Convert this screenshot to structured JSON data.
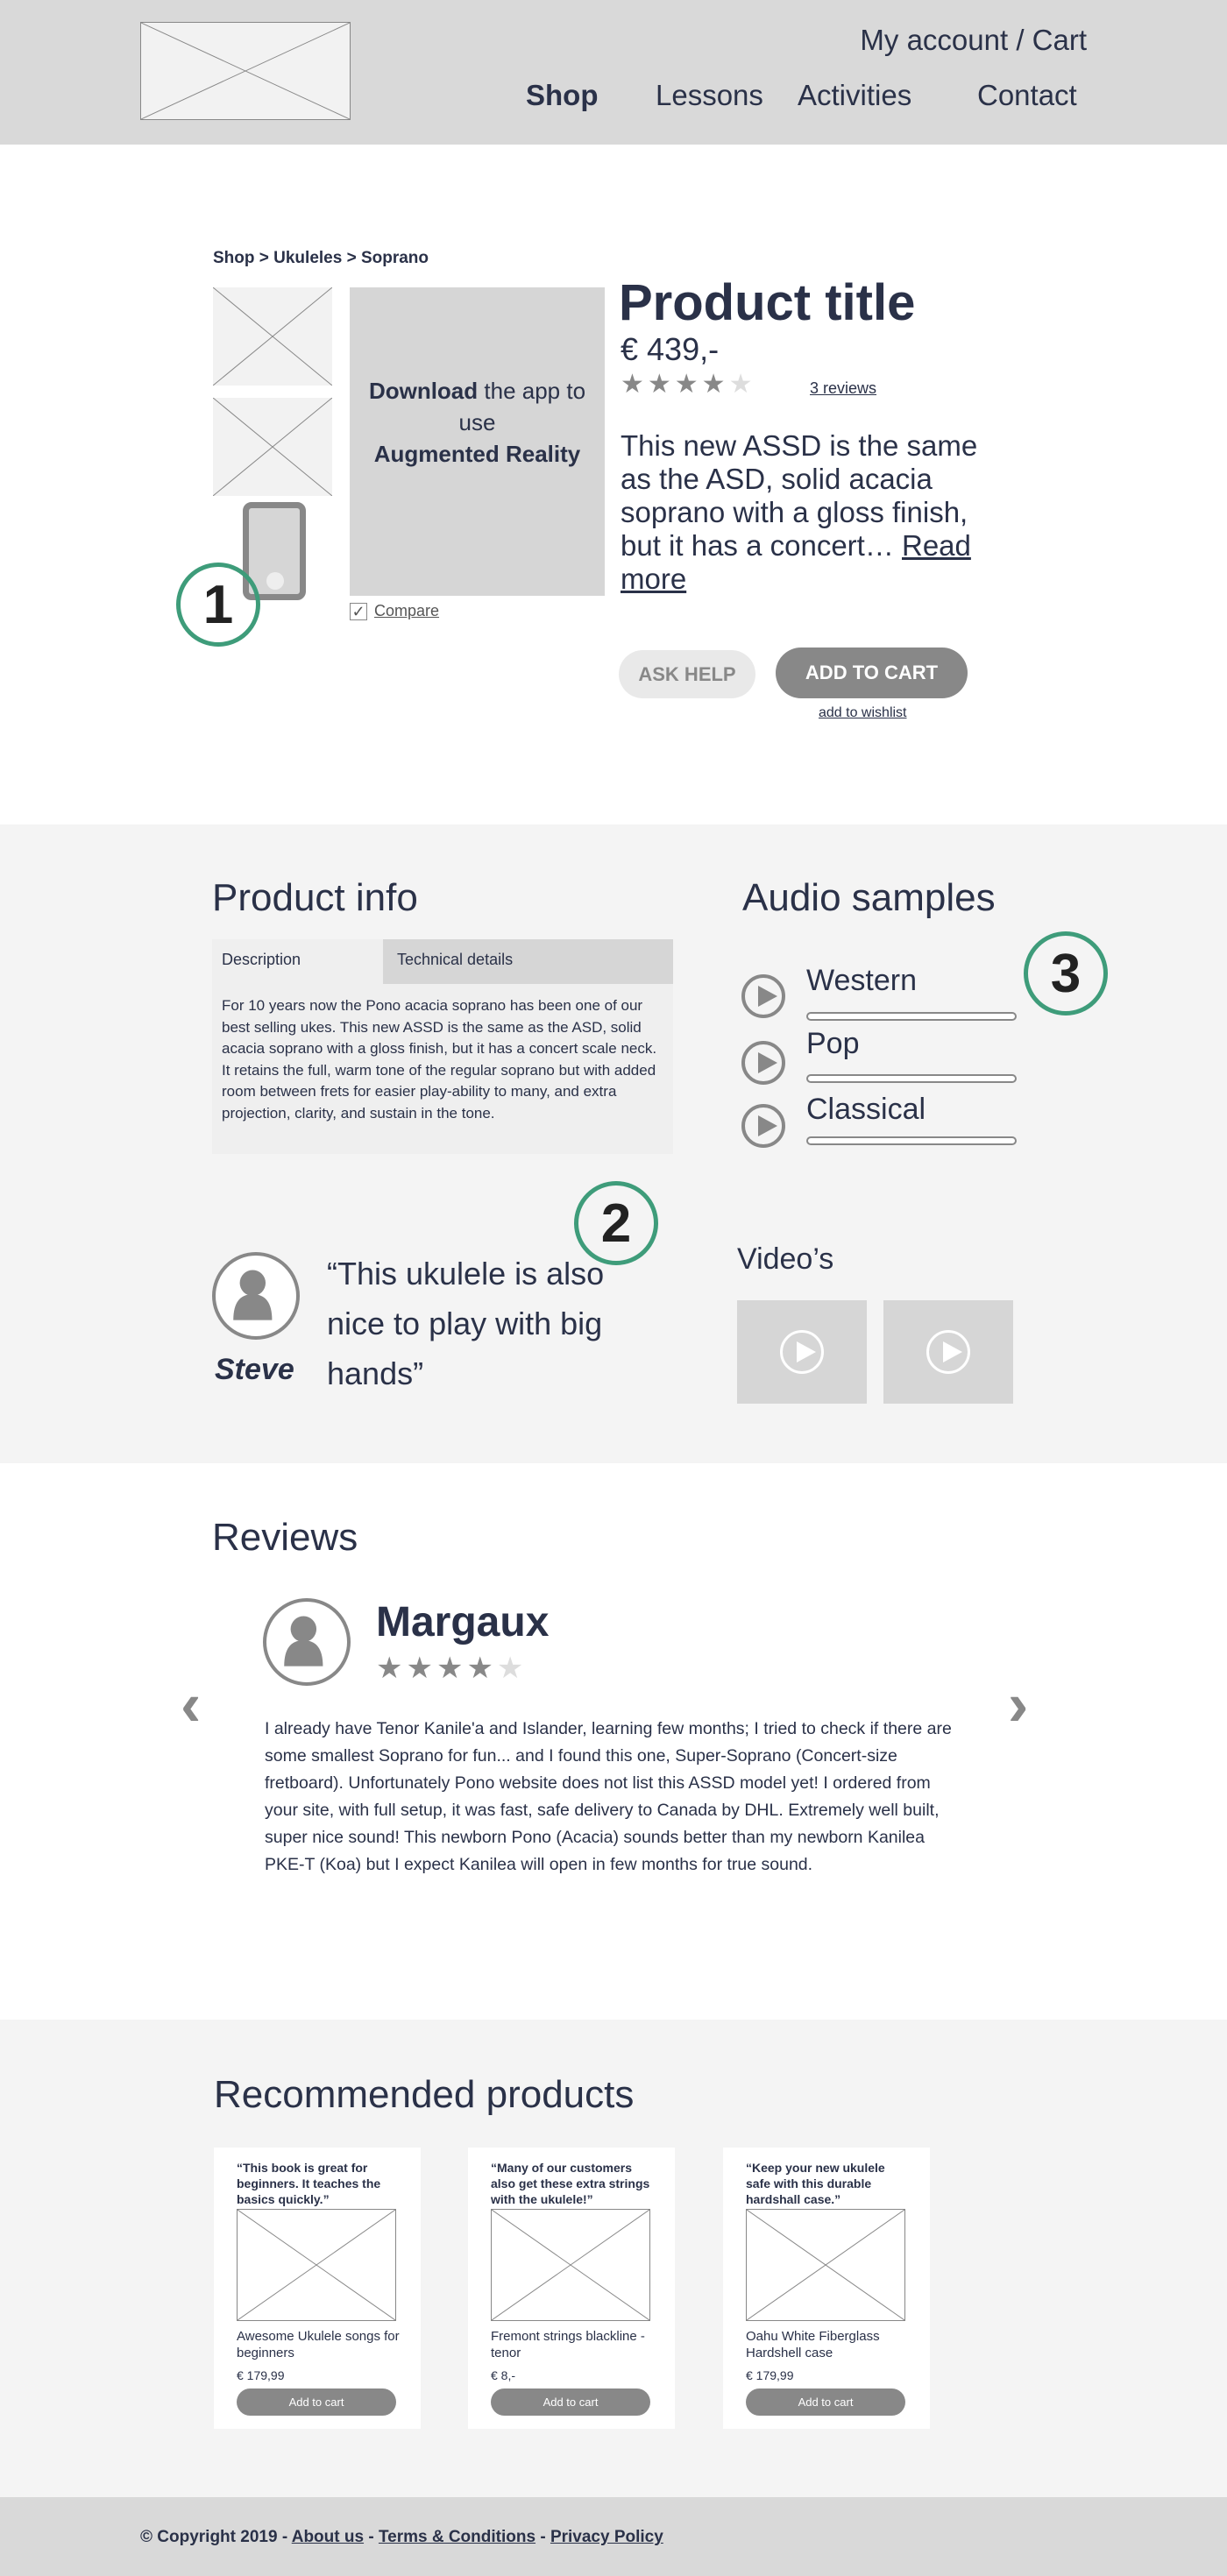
{
  "header": {
    "account_cart": "My account / Cart",
    "nav": [
      {
        "label": "Shop",
        "active": true
      },
      {
        "label": "Lessons"
      },
      {
        "label": "Activities"
      },
      {
        "label": "Contact"
      }
    ]
  },
  "product": {
    "breadcrumb": "Shop > Ukuleles > Soprano",
    "ar_promo": {
      "bold1": "Download",
      "text1": " the app to use",
      "bold2": "Augmented Reality"
    },
    "compare_label": "Compare",
    "compare_checked": true,
    "title": "Product title",
    "price": "€ 439,-",
    "rating": 4,
    "rating_max": 5,
    "reviews_link": "3 reviews",
    "description": "This new ASSD is the same as the ASD, solid acacia soprano with a gloss finish, but it has a concert…",
    "read_more": "Read more",
    "ask_help": "ASK HELP",
    "add_to_cart": "ADD TO CART",
    "add_to_wishlist": "add to wishlist"
  },
  "annotations": [
    "1",
    "2",
    "3"
  ],
  "product_info": {
    "heading": "Product info",
    "tabs": [
      "Description",
      "Technical details"
    ],
    "active_tab": "Description",
    "text": "For 10 years now the Pono acacia soprano has been one of our best selling ukes. This new ASSD is the same as the ASD, solid acacia soprano with a gloss finish, but it has a concert scale neck. It retains the full, warm tone of the regular soprano but with added room between frets for easier play-ability to many, and extra projection, clarity, and sustain in the tone."
  },
  "audio": {
    "heading": "Audio samples",
    "samples": [
      {
        "label": "Western",
        "progress": 0
      },
      {
        "label": "Pop",
        "progress": 0
      },
      {
        "label": "Classical",
        "progress": 0
      }
    ]
  },
  "testimonial": {
    "name": "Steve",
    "quote": "This ukulele is also nice to play with big hands",
    "open": "“",
    "close": "”"
  },
  "videos": {
    "heading": "Video’s"
  },
  "reviews": {
    "heading": "Reviews",
    "name": "Margaux",
    "rating": 4,
    "text": "I already have Tenor Kanile'a and Islander, learning few months; I tried to check if there are some smallest Soprano for fun... and I found this one, Super-Soprano (Concert-size fretboard). Unfortunately Pono website does not list this ASSD model yet! I ordered from your site, with full setup, it was fast, safe delivery to Canada by DHL. Extremely well built, super nice sound! This newborn Pono (Acacia) sounds better than my newborn Kanilea PKE-T (Koa) but I expect Kanilea will open in few months for true sound."
  },
  "recommended": {
    "heading": "Recommended products",
    "items": [
      {
        "quote": "“This book is great for beginners. It teaches the basics quickly.”",
        "name": "Awesome Ukulele songs for beginners",
        "price": "€ 179,99",
        "button": "Add to cart"
      },
      {
        "quote": "“Many of our customers also get these extra strings with the ukulele!”",
        "name": "Fremont strings blackline - tenor",
        "price": "€ 8,-",
        "button": "Add to cart"
      },
      {
        "quote": "“Keep your new ukulele safe with this durable hardshall case.”",
        "name": "Oahu White Fiberglass Hardshell case",
        "price": "€ 179,99",
        "button": "Add to cart"
      }
    ]
  },
  "footer": {
    "copyright": "© Copyright 2019 - ",
    "sep": " - ",
    "links": [
      "About us",
      "Terms & Conditions",
      "Privacy Policy"
    ]
  },
  "colors": {
    "text": "#2a3148",
    "annotation": "#3e9c7a",
    "header_bg": "#d9d9d9",
    "section_bg": "#f4f4f4",
    "button": "#888888"
  }
}
